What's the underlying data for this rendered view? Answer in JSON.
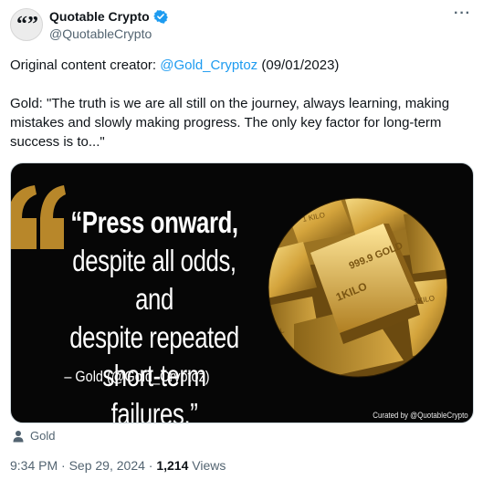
{
  "author": {
    "display_name": "Quotable Crypto",
    "handle": "@QuotableCrypto",
    "verified_color": "#1d9bf0"
  },
  "more_icon": "more-horizontal-icon",
  "tweet": {
    "credit_prefix": "Original content creator: ",
    "credit_mention": "@Gold_Cryptoz",
    "credit_date": " (09/01/2023)",
    "body": "Gold: \"The truth is we are all still on the journey, always learning, making mistakes and slowly making progress. The only key factor for long-term success is to...\""
  },
  "image": {
    "quote_lines": [
      "“Press onward,",
      "despite all odds, and",
      "despite repeated",
      "short-term failures.”"
    ],
    "attribution": "– Gold  (@Gold_Cryptoz)",
    "curated": "Curated by @QuotableCrypto",
    "bar_labels": [
      "1 KILO",
      "1KILO",
      "999.9 GOLD",
      "1KILO",
      "KIL"
    ]
  },
  "alt_label": "Gold",
  "meta": {
    "time": "9:34 PM",
    "separator": " · ",
    "date": "Sep 29, 2024",
    "views_count": "1,214",
    "views_label": " Views"
  },
  "colors": {
    "link": "#1d9bf0",
    "secondary_text": "#536471",
    "quote_mark": "#b8872a",
    "gold_light": "#f2d27a",
    "gold_dark": "#7a5512"
  }
}
